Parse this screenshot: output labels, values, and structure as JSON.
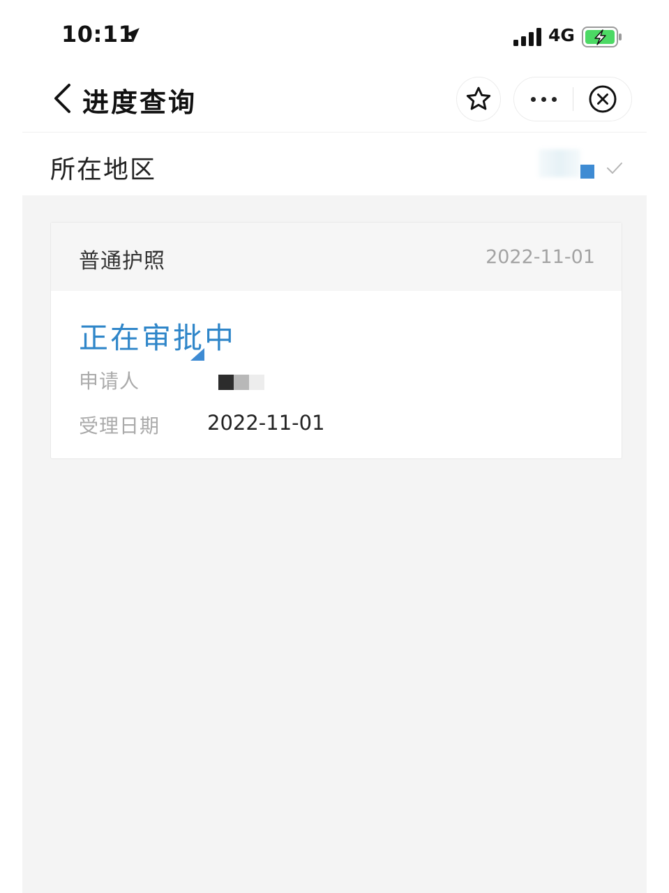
{
  "status_bar": {
    "time": "10:11",
    "network": "4G"
  },
  "nav": {
    "title": "进度查询"
  },
  "region": {
    "label": "所在地区"
  },
  "card": {
    "type": "普通护照",
    "header_date": "2022-11-01",
    "status": "正在审批中",
    "applicant_label": "申请人",
    "accept_date_label": "受理日期",
    "accept_date": "2022-11-01"
  },
  "colors": {
    "accent": "#2f86c9",
    "battery": "#4cd964",
    "page_bg": "#f4f4f4"
  },
  "icons": {
    "back": "back-chevron-icon",
    "favorite": "star-icon",
    "more": "more-dots-icon",
    "close": "close-circle-icon",
    "location": "location-arrow-icon",
    "signal": "signal-bars-icon",
    "battery": "battery-charging-icon",
    "check": "check-icon"
  }
}
